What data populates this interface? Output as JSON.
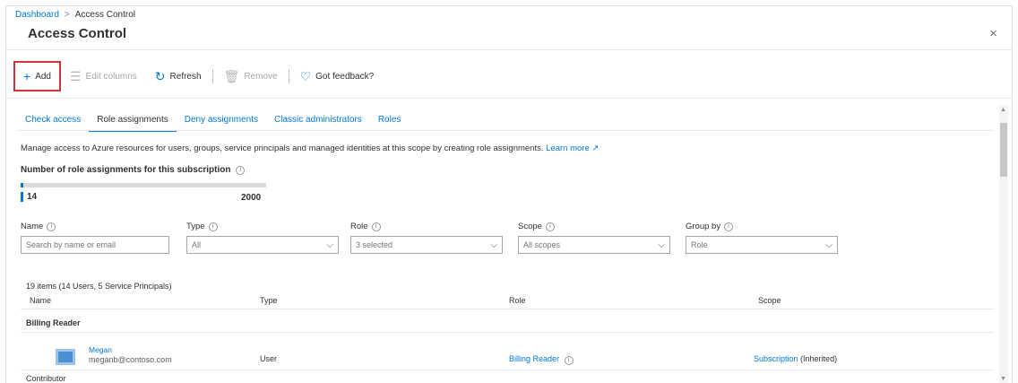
{
  "breadcrumb": {
    "home": "Dashboard",
    "separator": ">",
    "current": "Access Control"
  },
  "title": "Access Control",
  "close_icon": "×",
  "toolbar": {
    "add": "Add",
    "edit_columns": "Edit columns",
    "refresh": "Refresh",
    "remove": "Remove",
    "feedback": "Got feedback?"
  },
  "tabs": [
    "Check access",
    "Role assignments",
    "Deny assignments",
    "Classic administrators",
    "Roles"
  ],
  "active_tab": "Role assignments",
  "description": {
    "text": "Manage access to Azure resources for users, groups, service principals and managed identities at this scope by creating role assignments.",
    "link": "Learn more"
  },
  "role_count": {
    "title": "Number of role assignments for this subscription",
    "current": "14",
    "max": "2000",
    "fraction": 0.007
  },
  "filters": {
    "name": {
      "label": "Name",
      "placeholder": "Search by name or email"
    },
    "type": {
      "label": "Type",
      "value": "All"
    },
    "role": {
      "label": "Role",
      "value": "3 selected"
    },
    "scope": {
      "label": "Scope",
      "value": "All scopes"
    },
    "group_by": {
      "label": "Group by",
      "value": "Role"
    }
  },
  "items_count": "19 items (14 Users, 5 Service Principals)",
  "columns": [
    "Name",
    "Type",
    "Role",
    "Scope"
  ],
  "groups": [
    "Billing Reader",
    "Contributor"
  ],
  "rows": [
    {
      "name": "Megan",
      "email": "meganb@contoso.com",
      "type": "User",
      "role": "Billing Reader",
      "scope_link": "Subscription",
      "scope_suffix": "(Inherited)"
    }
  ],
  "colors": {
    "accent": "#0078d4",
    "highlight": "#d13438"
  }
}
